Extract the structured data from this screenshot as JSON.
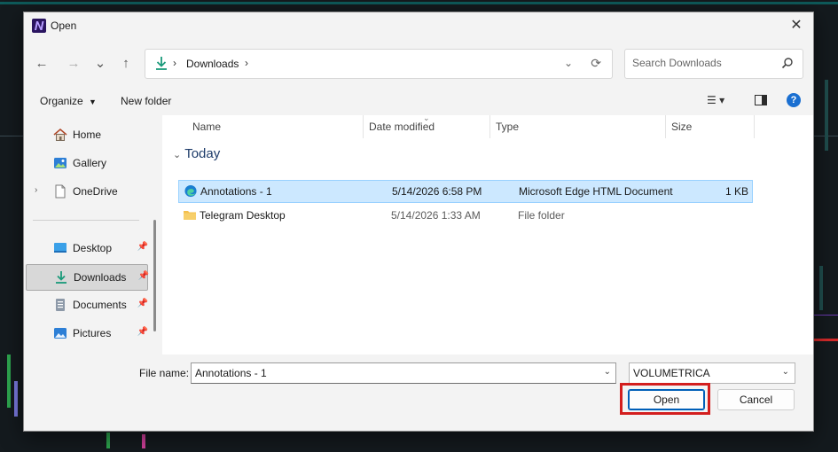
{
  "window": {
    "title": "Open"
  },
  "nav": {
    "back": "←",
    "forward": "→",
    "recent": "⌄",
    "up": "↑",
    "address_separator": "›",
    "address_location": "Downloads",
    "address_dropdown": "⌄",
    "refresh": "⟳",
    "search_placeholder": "Search Downloads"
  },
  "toolbar": {
    "organize_label": "Organize",
    "new_folder_label": "New folder",
    "help_label": "?",
    "view_label": "☰ ▾"
  },
  "sidebar": {
    "items": [
      {
        "label": "Home",
        "icon": "home-icon"
      },
      {
        "label": "Gallery",
        "icon": "gallery-icon"
      },
      {
        "label": "OneDrive",
        "icon": "onedrive-icon",
        "expander": "›"
      },
      {
        "label": "Desktop",
        "icon": "desktop-icon",
        "pinned": true
      },
      {
        "label": "Downloads",
        "icon": "downloads-icon",
        "pinned": true,
        "active": true
      },
      {
        "label": "Documents",
        "icon": "documents-icon",
        "pinned": true
      },
      {
        "label": "Pictures",
        "icon": "pictures-icon",
        "pinned": true
      }
    ]
  },
  "file_list": {
    "columns": [
      "Name",
      "Date modified",
      "Type",
      "Size"
    ],
    "group_label": "Today",
    "group_chevron": "⌄",
    "sort_indicator": "⌄",
    "rows": [
      {
        "name": "Annotations - 1",
        "date": "5/14/2026 6:58 PM",
        "type": "Microsoft Edge HTML Document",
        "size": "1 KB",
        "icon": "edge-html-icon",
        "selected": true
      },
      {
        "name": "Telegram Desktop",
        "date": "5/14/2026 1:33 AM",
        "type": "File folder",
        "size": "",
        "icon": "folder-icon",
        "selected": false
      }
    ]
  },
  "footer": {
    "file_name_label": "File name:",
    "file_name_value": "Annotations - 1",
    "file_type_value": "VOLUMETRICA",
    "dropdown_glyph": "⌄",
    "open_label": "Open",
    "cancel_label": "Cancel"
  },
  "colors": {
    "accent": "#005fb8",
    "selection": "#cce8ff",
    "highlight_box": "#d31e1e",
    "folder": "#f4c04e"
  }
}
